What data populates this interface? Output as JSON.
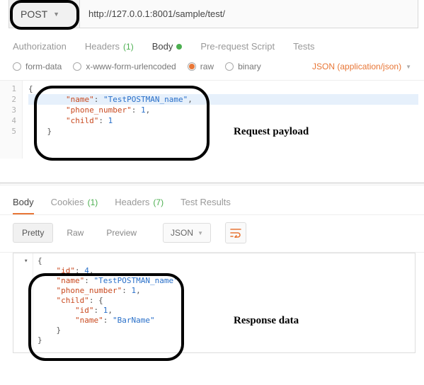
{
  "method": "POST",
  "url": "http://127.0.0.1:8001/sample/test/",
  "request_tabs": {
    "authorization": "Authorization",
    "headers": "Headers",
    "headers_count": "(1)",
    "body": "Body",
    "pre_request": "Pre-request Script",
    "tests": "Tests"
  },
  "body_types": {
    "form_data": "form-data",
    "urlencoded": "x-www-form-urlencoded",
    "raw": "raw",
    "binary": "binary"
  },
  "content_type": "JSON (application/json)",
  "request_payload": {
    "display_lines": [
      "{",
      "        \"name\": \"TestPOSTMAN_name\",",
      "        \"phone_number\": 1,",
      "        \"child\": 1",
      "    }"
    ],
    "json": {
      "name": "TestPOSTMAN_name",
      "phone_number": 1,
      "child": 1
    }
  },
  "annotation_request": "Request payload",
  "annotation_response": "Response data",
  "response_tabs": {
    "body": "Body",
    "cookies": "Cookies",
    "cookies_count": "(1)",
    "headers": "Headers",
    "headers_count": "(7)",
    "test_results": "Test Results"
  },
  "response_views": {
    "pretty": "Pretty",
    "raw": "Raw",
    "preview": "Preview"
  },
  "response_lang": "JSON",
  "response_data": {
    "display_lines": [
      "{",
      "    \"id\": 4,",
      "    \"name\": \"TestPOSTMAN_name\",",
      "    \"phone_number\": 1,",
      "    \"child\": {",
      "        \"id\": 1,",
      "        \"name\": \"BarName\"",
      "    }",
      "}"
    ],
    "json": {
      "id": 4,
      "name": "TestPOSTMAN_name",
      "phone_number": 1,
      "child": {
        "id": 1,
        "name": "BarName"
      }
    }
  }
}
